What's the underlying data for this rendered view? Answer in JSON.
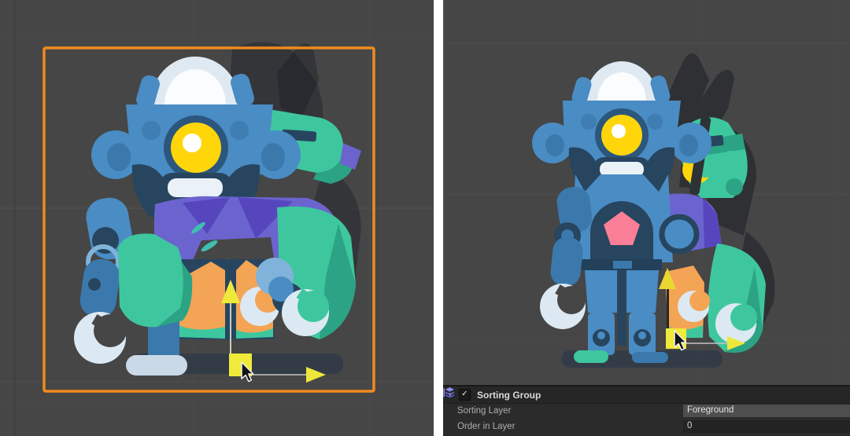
{
  "colors": {
    "scene_background": "#464646",
    "selection_outline_orange": "#F08A1E",
    "gizmo_yellow": "#F0EA3A",
    "divider_white": "#FFFFFF",
    "pentagon_pink": "#FB7F97",
    "robot_blue": "#4A8CC4",
    "robot_navy": "#27455F",
    "robot_teal": "#3EC79E",
    "robot_purple": "#6B64CE",
    "robot_orange": "#F4A455",
    "eye_yellow": "#FFD60A"
  },
  "icons": {
    "foldout_glyph": "▼",
    "check_glyph": "✓",
    "component_icon": "sorting-group-layers-icon",
    "gizmo": {
      "pivot": "yellow-square-handle",
      "y_axis": "yellow-up-arrow",
      "x_axis": "yellow-right-arrow"
    },
    "cursor": "mouse-arrow-pointer"
  },
  "inspector": {
    "component_title": "Sorting Group",
    "enabled": true,
    "rows": [
      {
        "label": "Sorting Layer",
        "value": "Foreground",
        "control": "dropdown"
      },
      {
        "label": "Order in Layer",
        "value": "0",
        "control": "number-field"
      }
    ]
  }
}
